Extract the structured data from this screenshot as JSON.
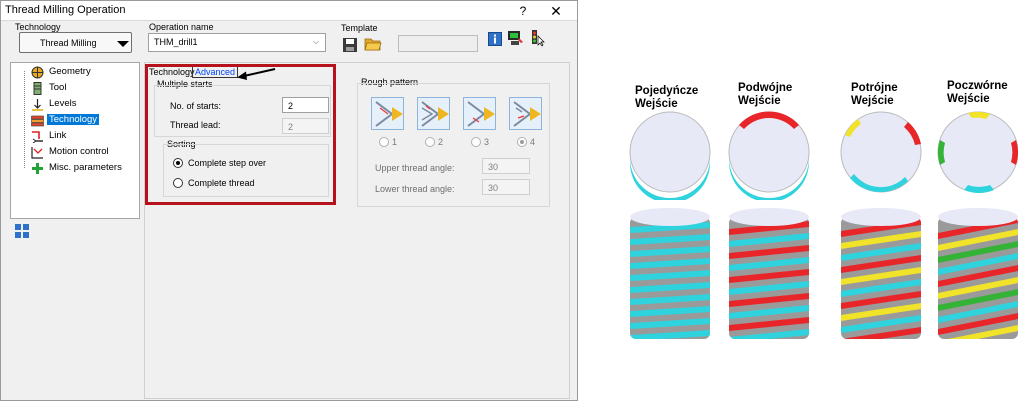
{
  "window": {
    "title": "Thread Milling Operation",
    "help": "?",
    "close": "✕"
  },
  "technology": {
    "label": "Technology",
    "value": "Thread Milling"
  },
  "operation": {
    "label": "Operation name",
    "value": "THM_drill1"
  },
  "template": {
    "label": "Template"
  },
  "tree": {
    "items": [
      {
        "label": "Geometry",
        "icon": "geometry-icon"
      },
      {
        "label": "Tool",
        "icon": "tool-icon"
      },
      {
        "label": "Levels",
        "icon": "levels-icon"
      },
      {
        "label": "Technology",
        "icon": "technology-icon",
        "selected": true
      },
      {
        "label": "Link",
        "icon": "link-icon"
      },
      {
        "label": "Motion control",
        "icon": "motion-control-icon"
      },
      {
        "label": "Misc. parameters",
        "icon": "misc-parameters-icon"
      }
    ]
  },
  "tabs": {
    "technology": "Technology",
    "advanced": "Advanced"
  },
  "multiple_starts": {
    "title": "Multiple starts",
    "starts_label": "No. of starts:",
    "starts_value": "2",
    "lead_label": "Thread lead:",
    "lead_value": "2"
  },
  "sorting": {
    "title": "Sorting",
    "options": [
      {
        "label": "Complete step over",
        "checked": true
      },
      {
        "label": "Complete thread",
        "checked": false
      }
    ]
  },
  "rough_pattern": {
    "title": "Rough pattern",
    "options": [
      "1",
      "2",
      "3",
      "4"
    ],
    "selected": "4",
    "upper_label": "Upper thread angle:",
    "upper_value": "30",
    "lower_label": "Lower thread angle:",
    "lower_value": "30"
  },
  "figure": {
    "captions": [
      {
        "line1": "Pojedyńcze",
        "line2": "Wejście"
      },
      {
        "line1": "Podwójne",
        "line2": "Wejście"
      },
      {
        "line1": "Potrójne",
        "line2": "Wejście"
      },
      {
        "line1": "Poczwórne",
        "line2": "Wejście"
      }
    ],
    "colors": {
      "cyan": "#2fd3de",
      "red": "#e8262a",
      "yellow": "#f1e22a",
      "green": "#35b336",
      "gray": "#9a9a9a",
      "top": "#e7e9f7"
    }
  },
  "colors": {
    "accent": "#0078d7",
    "highlight": "#b5121b",
    "link": "#0044ff"
  }
}
